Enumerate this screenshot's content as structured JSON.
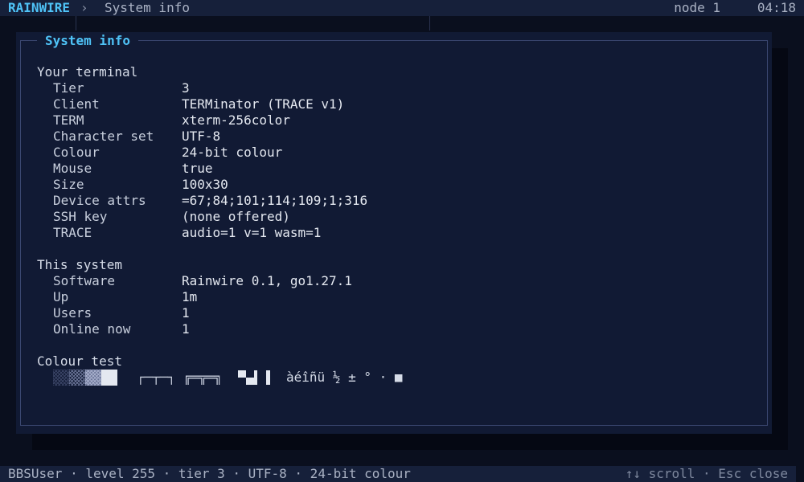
{
  "header": {
    "brand": "RAINWIRE",
    "separator": "›",
    "breadcrumb": "System info",
    "node": "node 1",
    "clock": "04:18"
  },
  "panel": {
    "title": "System info"
  },
  "terminal": {
    "heading": "Your terminal",
    "rows": [
      {
        "key": "Tier",
        "value": "3"
      },
      {
        "key": "Client",
        "value": "TERMinator (TRACE v1)"
      },
      {
        "key": "TERM",
        "value": "xterm-256color"
      },
      {
        "key": "Character set",
        "value": "UTF-8"
      },
      {
        "key": "Colour",
        "value": "24-bit colour"
      },
      {
        "key": "Mouse",
        "value": "true"
      },
      {
        "key": "Size",
        "value": "100x30"
      },
      {
        "key": "Device attrs",
        "value": "=67;84;101;114;109;1;316"
      },
      {
        "key": "SSH key",
        "value": "(none offered)"
      },
      {
        "key": "TRACE",
        "value": "audio=1 v=1 wasm=1"
      }
    ]
  },
  "system": {
    "heading": "This system",
    "rows": [
      {
        "key": "Software",
        "value": "Rainwire 0.1, go1.27.1"
      },
      {
        "key": "Up",
        "value": "1m"
      },
      {
        "key": "Users",
        "value": "1"
      },
      {
        "key": "Online now",
        "value": "1"
      }
    ]
  },
  "colour_test": {
    "heading": "Colour test",
    "box_single": "┌─┬─┐",
    "box_double": "╔═╦═╗",
    "chars": "àéîñü ½ ± ° · ■",
    "shade_colors": [
      "#3a4466",
      "#6b7598",
      "#a7afcc",
      "#e4e8f0"
    ]
  },
  "status": {
    "left": "BBSUser · level 255 · tier 3 · UTF-8 · 24-bit colour",
    "right": "↑↓ scroll · Esc close"
  },
  "colors": {
    "accent": "#4fc3f7",
    "background": "#0a0f1e",
    "panel": "#111a34"
  }
}
